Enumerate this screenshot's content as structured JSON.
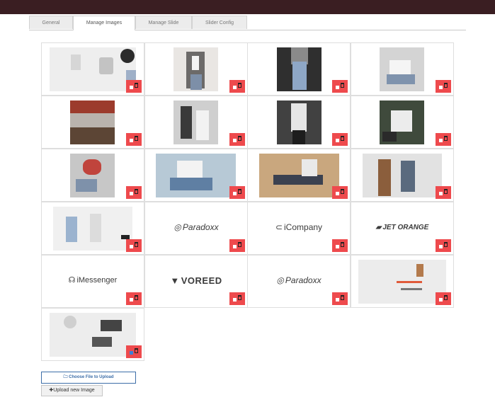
{
  "tabs": [
    {
      "label": "General"
    },
    {
      "label": "Manage Images"
    },
    {
      "label": "Manage Slide"
    },
    {
      "label": "Slider Config"
    }
  ],
  "active_tab": "Manage Images",
  "logos": {
    "paradoxx": "Paradoxx",
    "icompany": "iCompany",
    "jet_orange": "JET ORANGE",
    "imessenger": "iMessenger",
    "voreed": "VOREED",
    "paradoxx_2": "Paradoxx"
  },
  "buttons": {
    "choose_file": "Choose File to Upload",
    "upload_new": "Upload new Image"
  },
  "icons": {
    "folder": "folder-icon",
    "plus": "plus-icon",
    "delete": "trash-icon"
  },
  "colors": {
    "select_badge": "#ee4a4d",
    "accent_blue": "#3d6ea8",
    "topbar": "#3a1e22"
  },
  "last_image_checked": true
}
